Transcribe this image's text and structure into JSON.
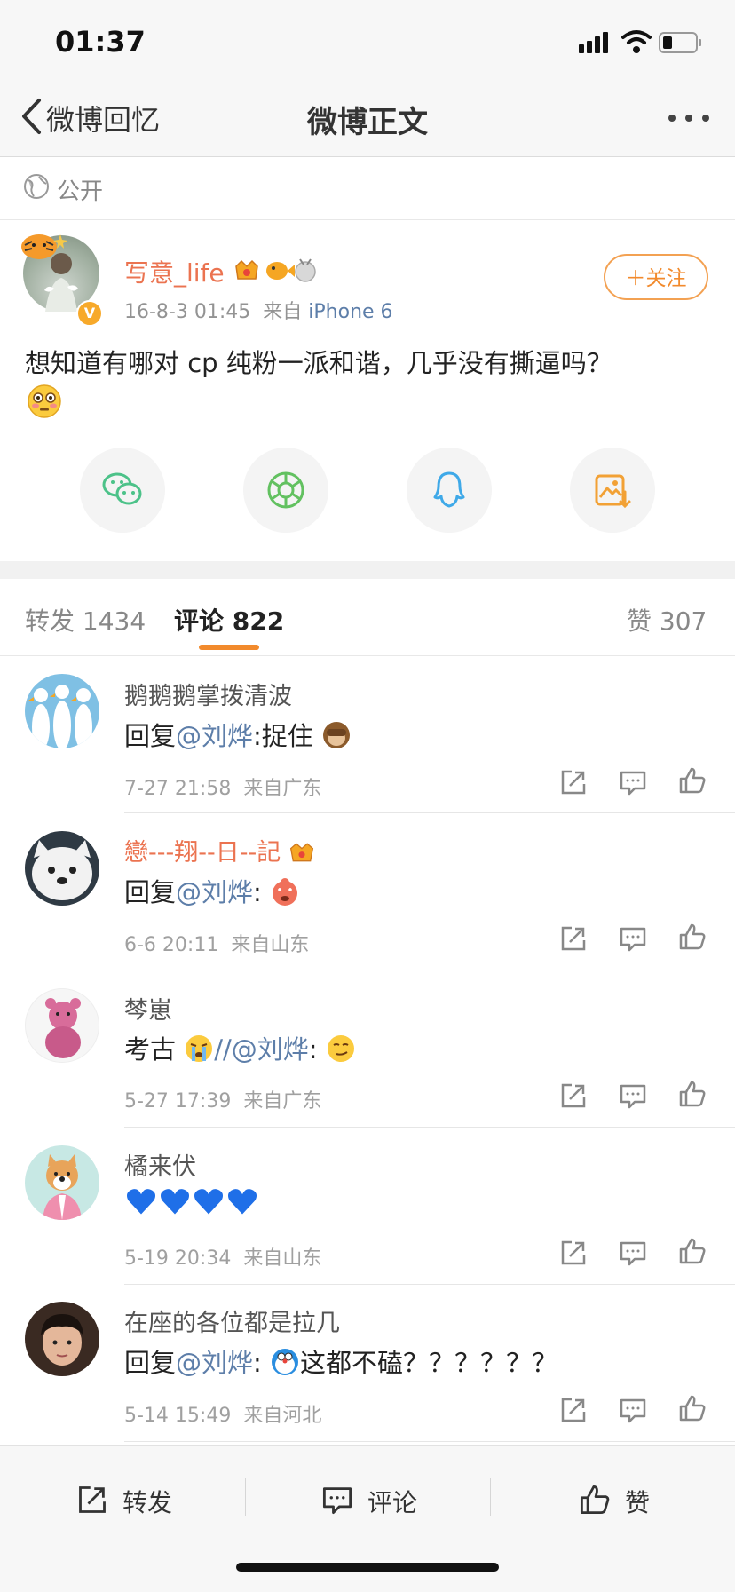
{
  "status_bar": {
    "time": "01:37"
  },
  "nav": {
    "back_label": "微博回忆",
    "title": "微博正文"
  },
  "visibility": {
    "label": "公开"
  },
  "post": {
    "username": "写意_life",
    "time": "16-8-3 01:45",
    "source_prefix": "来自",
    "source": "iPhone 6",
    "follow_label": "＋关注",
    "text": "想知道有哪对 cp 纯粉一派和谐，几乎没有撕逼吗？"
  },
  "tabs": {
    "repost": "转发 1434",
    "comment": "评论 822",
    "like": "赞 307"
  },
  "comments": [
    {
      "name": "鹅鹅鹅掌拨清波",
      "prefix": "回复",
      "mention": "@刘烨",
      "suffix": ":捉住",
      "time": "7-27 21:58",
      "source": "来自广东"
    },
    {
      "name": "戀---翔--日--記",
      "prefix": "回复",
      "mention": "@刘烨",
      "suffix": ":",
      "time": "6-6 20:11",
      "source": "来自山东"
    },
    {
      "name": "棽崽",
      "prefix": "考古 ",
      "mention": "//@刘烨",
      "suffix": ":",
      "time": "5-27 17:39",
      "source": "来自广东"
    },
    {
      "name": "橘来伏",
      "prefix": "",
      "mention": "",
      "suffix": "",
      "time": "5-19 20:34",
      "source": "来自山东"
    },
    {
      "name": "在座的各位都是拉几",
      "prefix": "回复",
      "mention": "@刘烨",
      "suffix": ":",
      "rest": "这都不磕？？？？？？",
      "time": "5-14 15:49",
      "source": "来自河北"
    }
  ],
  "bottom": {
    "repost": "转发",
    "comment": "评论",
    "like": "赞"
  },
  "colors": {
    "accent": "#f28a2c",
    "name_vip": "#eb7350",
    "link": "#5d7ea9"
  }
}
